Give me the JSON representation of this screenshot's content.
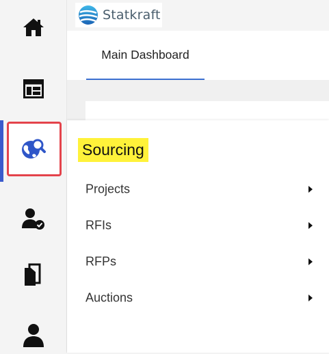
{
  "sidebar": {
    "items": [
      {
        "name": "home-icon"
      },
      {
        "name": "dashboard-layout-icon"
      },
      {
        "name": "globe-search-icon",
        "active": true
      },
      {
        "name": "user-check-icon"
      },
      {
        "name": "documents-icon"
      },
      {
        "name": "user-icon"
      }
    ],
    "active_color": "#3b5bcc",
    "highlight_color": "#e4434b"
  },
  "header": {
    "logo_text": "Statkraft"
  },
  "tabs": [
    {
      "label": "Main Dashboard",
      "active": true
    }
  ],
  "flyout": {
    "title": "Sourcing",
    "title_highlight_color": "#fff23a",
    "items": [
      {
        "label": "Projects"
      },
      {
        "label": "RFIs"
      },
      {
        "label": "RFPs"
      },
      {
        "label": "Auctions"
      }
    ]
  }
}
